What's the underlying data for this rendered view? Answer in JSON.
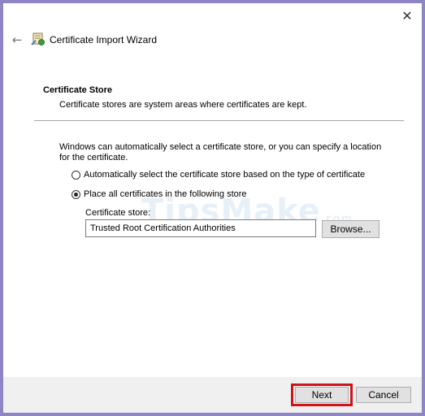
{
  "window": {
    "title": "Certificate Import Wizard",
    "close_glyph": "✕",
    "back_glyph": "←"
  },
  "page": {
    "section_title": "Certificate Store",
    "section_description": "Certificate stores are system areas where certificates are kept.",
    "intro": "Windows can automatically select a certificate store, or you can specify a location for the certificate."
  },
  "options": {
    "auto_label": "Automatically select the certificate store based on the type of certificate",
    "auto_selected": false,
    "manual_label": "Place all certificates in the following store",
    "manual_selected": true
  },
  "store": {
    "label": "Certificate store:",
    "value": "Trusted Root Certification Authorities",
    "browse_label": "Browse..."
  },
  "footer": {
    "next_label": "Next",
    "cancel_label": "Cancel"
  },
  "watermark": {
    "text": "TipsMake",
    "suffix": ".com"
  },
  "colors": {
    "highlight": "#d0121b",
    "frame": "#8e86c4"
  }
}
